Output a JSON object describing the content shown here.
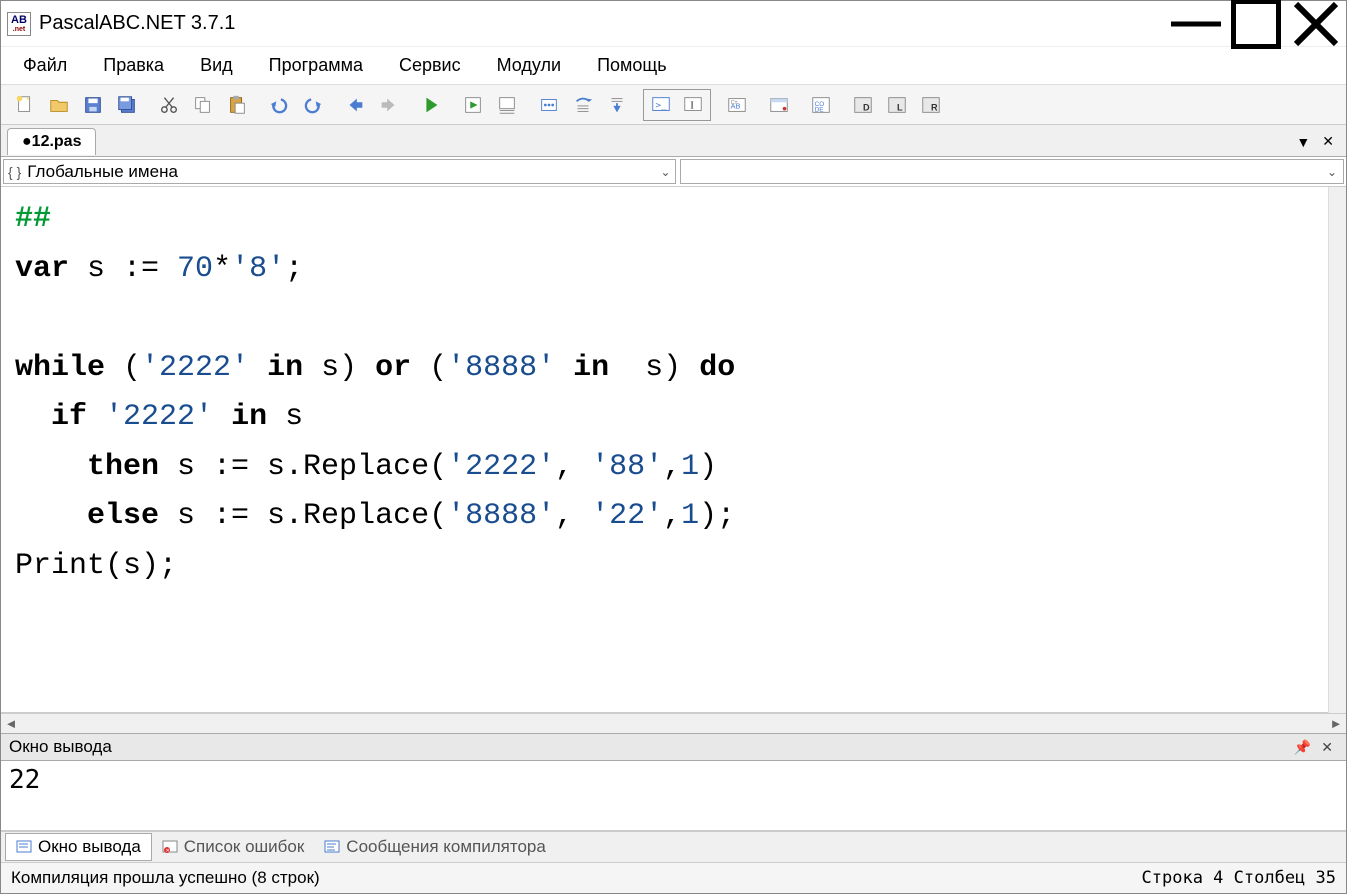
{
  "window": {
    "title": "PascalABC.NET 3.7.1"
  },
  "menu": {
    "items": [
      "Файл",
      "Правка",
      "Вид",
      "Программа",
      "Сервис",
      "Модули",
      "Помощь"
    ]
  },
  "tabs": {
    "active": "●12.pas"
  },
  "navigator": {
    "scope": "Глобальные имена"
  },
  "code": {
    "line1_hash": "##",
    "line2_var": "var",
    "line2_rest_a": " s := ",
    "line2_num": "70",
    "line2_rest_b": "*",
    "line2_str": "'8'",
    "line2_semi": ";",
    "line4_while": "while",
    "line4_a": " (",
    "line4_s1": "'2222'",
    "line4_in1": " in",
    "line4_b": " s) ",
    "line4_or": "or",
    "line4_c": " (",
    "line4_s2": "'8888'",
    "line4_in2": " in",
    "line4_d": "  s) ",
    "line4_do": "do",
    "line5_if": "  if",
    "line5_a": " ",
    "line5_s": "'2222'",
    "line5_in": " in",
    "line5_b": " s",
    "line6_then": "    then",
    "line6_a": " s := s.Replace(",
    "line6_s1": "'2222'",
    "line6_b": ", ",
    "line6_s2": "'88'",
    "line6_c": ",",
    "line6_n": "1",
    "line6_d": ")",
    "line7_else": "    else",
    "line7_a": " s := s.Replace(",
    "line7_s1": "'8888'",
    "line7_b": ", ",
    "line7_s2": "'22'",
    "line7_c": ",",
    "line7_n": "1",
    "line7_d": ");",
    "line8": "Print(s);"
  },
  "output": {
    "title": "Окно вывода",
    "content": "22"
  },
  "bottom_tabs": {
    "t1": "Окно вывода",
    "t2": "Список ошибок",
    "t3": "Сообщения компилятора"
  },
  "status": {
    "left": "Компиляция прошла успешно (8 строк)",
    "right": "Строка 4 Столбец 35"
  }
}
